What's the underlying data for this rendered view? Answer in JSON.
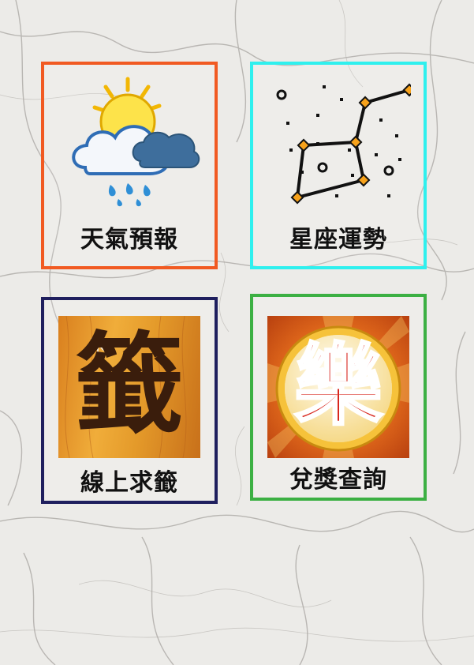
{
  "tiles": [
    {
      "label": "天氣預報",
      "border_color": "#f15a22",
      "icon": "weather-icon"
    },
    {
      "label": "星座運勢",
      "border_color": "#2ff0ee",
      "icon": "constellation-icon"
    },
    {
      "label": "線上求籤",
      "border_color": "#1f1f5e",
      "icon": "fortune-stick-icon"
    },
    {
      "label": "兌獎查詢",
      "border_color": "#3cb043",
      "icon": "lottery-icon"
    }
  ],
  "fortune_glyph": "籤",
  "lottery_glyph": "樂",
  "colors": {
    "marble_base": "#ecebe8",
    "wood": "#e39a2c",
    "lottery_red": "#d8261d",
    "lottery_gold": "#f6c23a"
  }
}
